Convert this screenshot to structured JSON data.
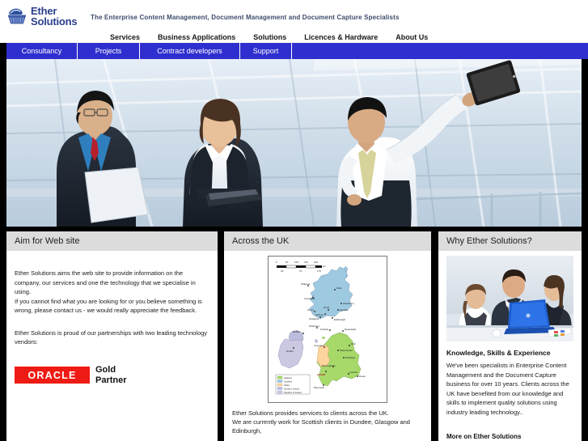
{
  "site": {
    "logo_line1": "Ether",
    "logo_line2": "Solutions",
    "logo_icon": "ether-basket-logo-icon",
    "tagline": "The Enterprise Content Management, Document Management and Document Capture Specialists",
    "accent_blue": "#2f2fcf",
    "logo_blue": "#2b3f8c",
    "panel_header_grey": "#dcdcdc",
    "oracle_red": "#ee1b14"
  },
  "main_nav": [
    {
      "label": "Services"
    },
    {
      "label": "Business Applications"
    },
    {
      "label": "Solutions"
    },
    {
      "label": "Licences & Hardware"
    },
    {
      "label": "About Us"
    }
  ],
  "sub_nav": [
    {
      "label": "Consultancy"
    },
    {
      "label": "Projects"
    },
    {
      "label": "Contract developers"
    },
    {
      "label": "Support"
    }
  ],
  "hero": {
    "alt": "Three business colleagues in a modern glass office, one reaching up with a tablet"
  },
  "panels": {
    "aim": {
      "title": "Aim for Web site",
      "paragraph1": "Ether Solutions aims the web site to provide information on the company, our services and one the technology that we specialise in using.\nIf you cannot find what you are looking for or you believe something is wrong, please contact us - we would really appreciate the feedback.",
      "paragraph2": "Ether Solutions is proud of our partnerships with two leading technology vendors:",
      "oracle_word": "ORACLE",
      "oracle_tm": "®",
      "gold_line1": "Gold",
      "gold_line2": "Partner"
    },
    "uk": {
      "title": "Across the UK",
      "map_alt": "Map of the United Kingdom and Ireland with regions shaded and cities marked",
      "map_scale": "0   50   100   150   200 km",
      "map_legend": [
        {
          "label": "England",
          "color": "#a6d96a"
        },
        {
          "label": "Scotland",
          "color": "#9ecae1"
        },
        {
          "label": "Wales",
          "color": "#fdd49e"
        },
        {
          "label": "Northern Ireland",
          "color": "#bcbddc"
        },
        {
          "label": "Republic of Ireland",
          "color": "#cbc9e2"
        }
      ],
      "map_cities": [
        "Wick",
        "Aberdeen",
        "Dundee",
        "Perth",
        "Stirling",
        "Glasgow",
        "Edinburgh",
        "Oban",
        "Inverness",
        "Ullapool",
        "Stranraer",
        "Belfast",
        "Dublin",
        "Carlisle",
        "Newcastle",
        "Hull",
        "Liverpool",
        "Manchester",
        "Sheffield",
        "Birmingham",
        "London",
        "Dover",
        "Cardiff",
        "Plymouth"
      ],
      "paragraph": "Ether Solutions provides services to clients across the UK.\nWe are currently work for Scottish clients in Dundee, Glasgow and Edinburgh,"
    },
    "why": {
      "title": "Why Ether Solutions?",
      "photo_alt": "Three colleagues looking at a blue laptop at a meeting table",
      "subhead": "Knowledge, Skills & Experience",
      "body": "We've been specialists in Enterprise Content Management and the Document Capture business for over 10 years. Clients across the UK have benefited from our knowledge and skills to implement quality solutions using industry leading technology..",
      "more_link": "More on Ether Solutions"
    }
  }
}
